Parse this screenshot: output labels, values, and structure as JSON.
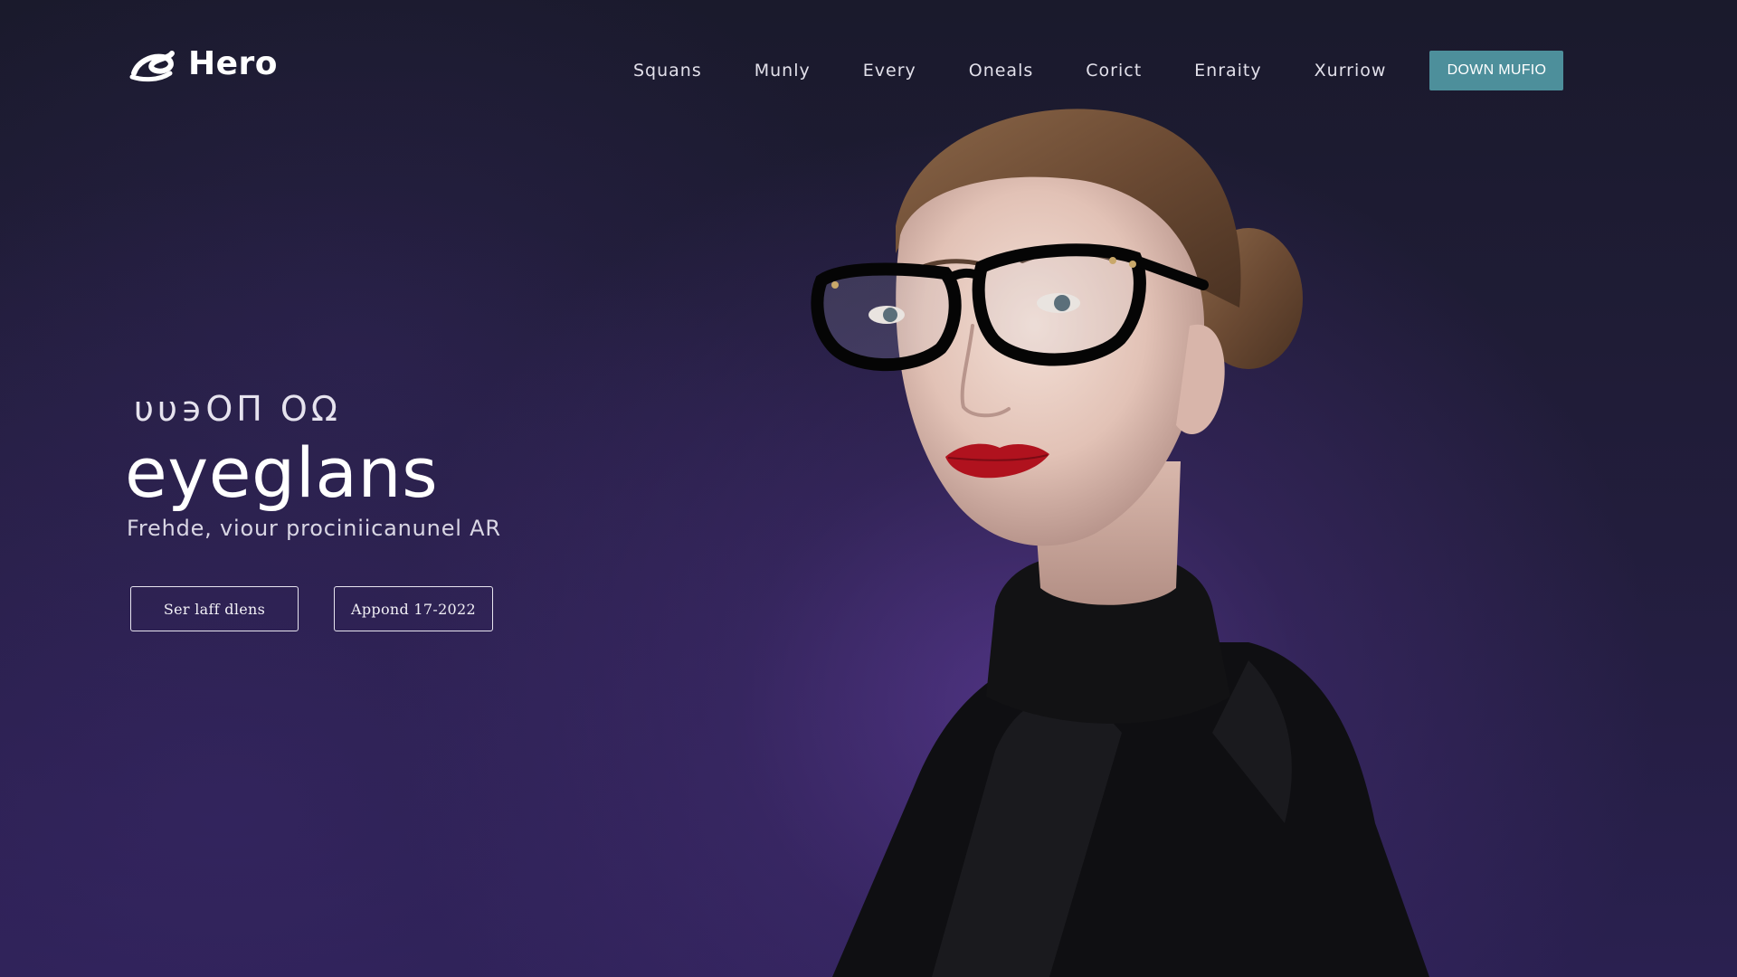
{
  "brand": {
    "name": "Hero",
    "logo_icon": "swirl-logo-icon"
  },
  "nav": {
    "items": [
      {
        "label": "Squans"
      },
      {
        "label": "Munly"
      },
      {
        "label": "Every"
      },
      {
        "label": "Oneals"
      },
      {
        "label": "Corict"
      },
      {
        "label": "Enraity"
      },
      {
        "label": "Xurriow"
      }
    ],
    "cta_label": "DOWN MUFIO"
  },
  "hero": {
    "eyebrow": "υυ϶ΟΠ ΟΩ",
    "title": "eyeglans",
    "subtitle": "Frehde, viour prociniicanunel AR",
    "primary_button": "Ser laff dlens",
    "secondary_button": "Appond 17-2022"
  },
  "colors": {
    "background": "#1b1930",
    "accent_purple": "#5c3a96",
    "cta_teal": "#4d8f9b",
    "text_light": "#e6e3ee"
  }
}
